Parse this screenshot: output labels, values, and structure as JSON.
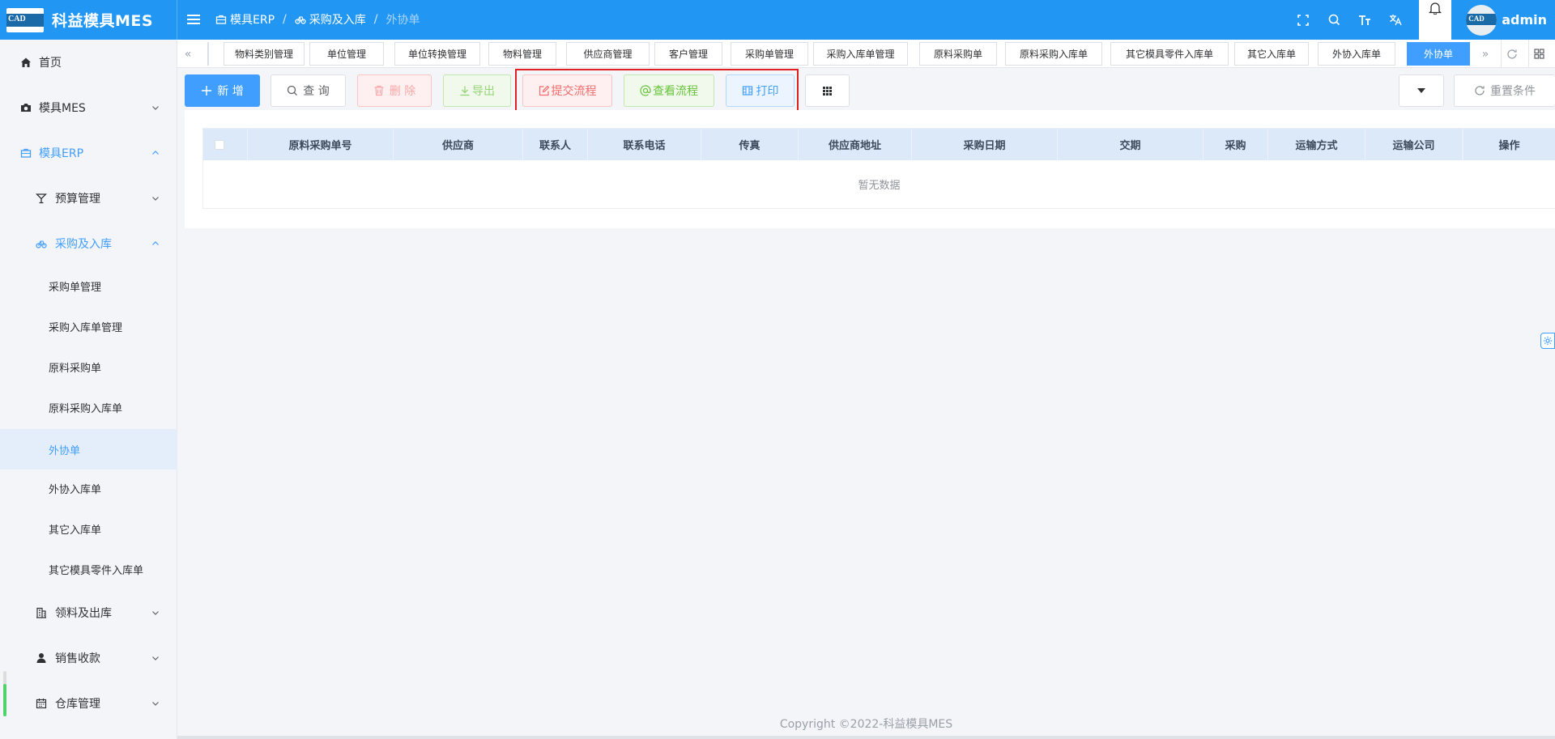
{
  "app": {
    "title": "科益模具MES",
    "logo_text": "CAD"
  },
  "header": {
    "breadcrumb": [
      {
        "label": "模具ERP",
        "icon": "briefcase-icon"
      },
      {
        "label": "采购及入库",
        "icon": "bicycle-icon"
      },
      {
        "label": "外协单"
      }
    ],
    "separator": "/",
    "icons": [
      "fullscreen-icon",
      "search-icon",
      "font-size-icon",
      "translate-icon",
      "bell-icon"
    ],
    "username": "admin"
  },
  "sidebar": {
    "items": [
      {
        "label": "首页",
        "icon": "home-icon"
      },
      {
        "label": "模具MES",
        "icon": "camera-icon"
      },
      {
        "label": "模具ERP",
        "icon": "briefcase-icon"
      },
      {
        "label": "预算管理",
        "icon": "cocktail-icon"
      },
      {
        "label": "采购及入库",
        "icon": "bicycle-icon"
      },
      {
        "label": "采购单管理"
      },
      {
        "label": "采购入库单管理"
      },
      {
        "label": "原料采购单"
      },
      {
        "label": "原料采购入库单"
      },
      {
        "label": "外协单"
      },
      {
        "label": "外协入库单"
      },
      {
        "label": "其它入库单"
      },
      {
        "label": "其它模具零件入库单"
      },
      {
        "label": "领料及出库",
        "icon": "building-icon"
      },
      {
        "label": "销售收款",
        "icon": "user-icon"
      },
      {
        "label": "仓库管理",
        "icon": "calendar-icon"
      }
    ]
  },
  "tags": [
    {
      "label": "物料类别管理"
    },
    {
      "label": "单位管理"
    },
    {
      "label": "单位转换管理"
    },
    {
      "label": "物料管理"
    },
    {
      "label": "供应商管理"
    },
    {
      "label": "客户管理"
    },
    {
      "label": "采购单管理"
    },
    {
      "label": "采购入库单管理"
    },
    {
      "label": "原料采购单"
    },
    {
      "label": "原料采购入库单"
    },
    {
      "label": "其它模具零件入库单"
    },
    {
      "label": "其它入库单"
    },
    {
      "label": "外协入库单"
    },
    {
      "label": "外协单",
      "active": true
    }
  ],
  "toolbar": {
    "add": "新 增",
    "query": "查 询",
    "delete": "删 除",
    "export": "导出",
    "submit_flow": "提交流程",
    "view_flow": "查看流程",
    "print": "打印",
    "reset": "重置条件"
  },
  "table": {
    "columns": [
      "原料采购单号",
      "供应商",
      "联系人",
      "联系电话",
      "传真",
      "供应商地址",
      "采购日期",
      "交期",
      "采购",
      "运输方式",
      "运输公司",
      "操作"
    ],
    "empty_text": "暂无数据",
    "rows": []
  },
  "footer": {
    "copyright": "Copyright ©2022-科益模具MES"
  },
  "colors": {
    "primary": "#2196f3",
    "accent": "#409eff",
    "danger": "#f56c6c",
    "success": "#67c23a",
    "highlight": "#e02020"
  }
}
